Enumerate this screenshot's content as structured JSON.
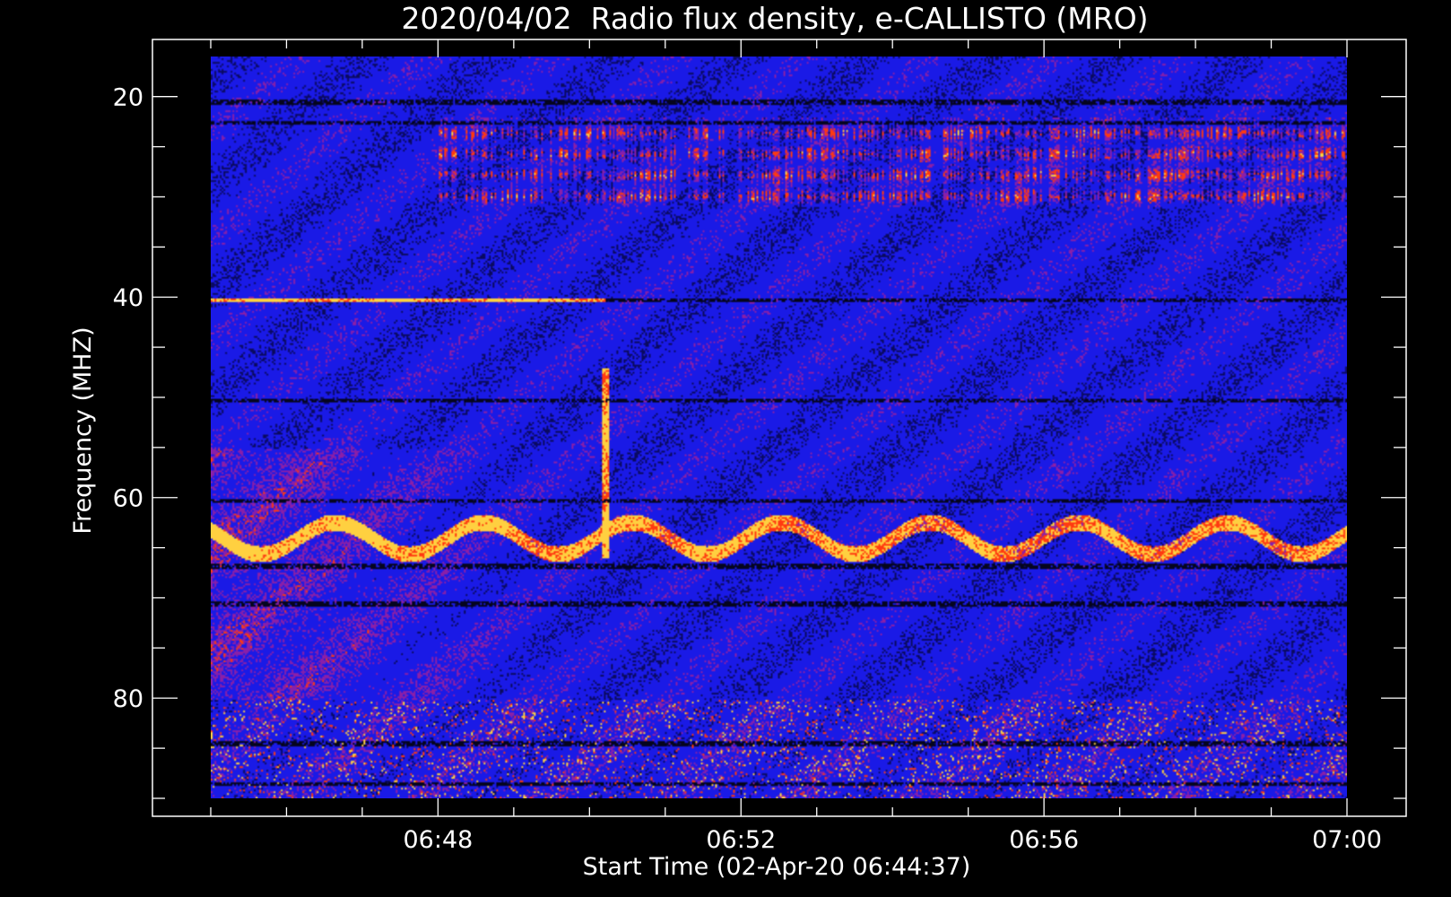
{
  "chart_data": {
    "type": "heatmap",
    "title": "2020/04/02  Radio flux density, e-CALLISTO (MRO)",
    "xlabel": "Start Time (02-Apr-20 06:44:37)",
    "ylabel": "Frequency (MHZ)",
    "x_range": [
      "06:45:00",
      "07:00:00"
    ],
    "y_range_mhz": [
      16,
      90
    ],
    "y_inverted": true,
    "x_ticks": [
      {
        "label": "06:48",
        "minutes": 48
      },
      {
        "label": "06:52",
        "minutes": 52
      },
      {
        "label": "06:56",
        "minutes": 56
      },
      {
        "label": "07:00",
        "minutes": 60
      }
    ],
    "y_ticks": [
      {
        "label": "20",
        "mhz": 20
      },
      {
        "label": "40",
        "mhz": 40
      },
      {
        "label": "60",
        "mhz": 60
      },
      {
        "label": "80",
        "mhz": 80
      }
    ],
    "x_minor_step_min": 1,
    "y_minor_step_mhz": 5,
    "colors": {
      "background": "#000000",
      "base": "#1a1ae6",
      "dark": "#0a0a60",
      "mid": "#8a1fa8",
      "hot": "#ff3a10",
      "peak": "#ffd040"
    },
    "features": {
      "persistent_lines_mhz": [
        20.5,
        22.5,
        40.2,
        50.2,
        60.2,
        66.8,
        70.5,
        84.5,
        88.5
      ],
      "interference_band_mhz": [
        22,
        31
      ],
      "wave_band_center_mhz": 64,
      "burst_start_min": 50.2,
      "burst_freq_range_mhz": [
        47,
        66
      ]
    }
  }
}
